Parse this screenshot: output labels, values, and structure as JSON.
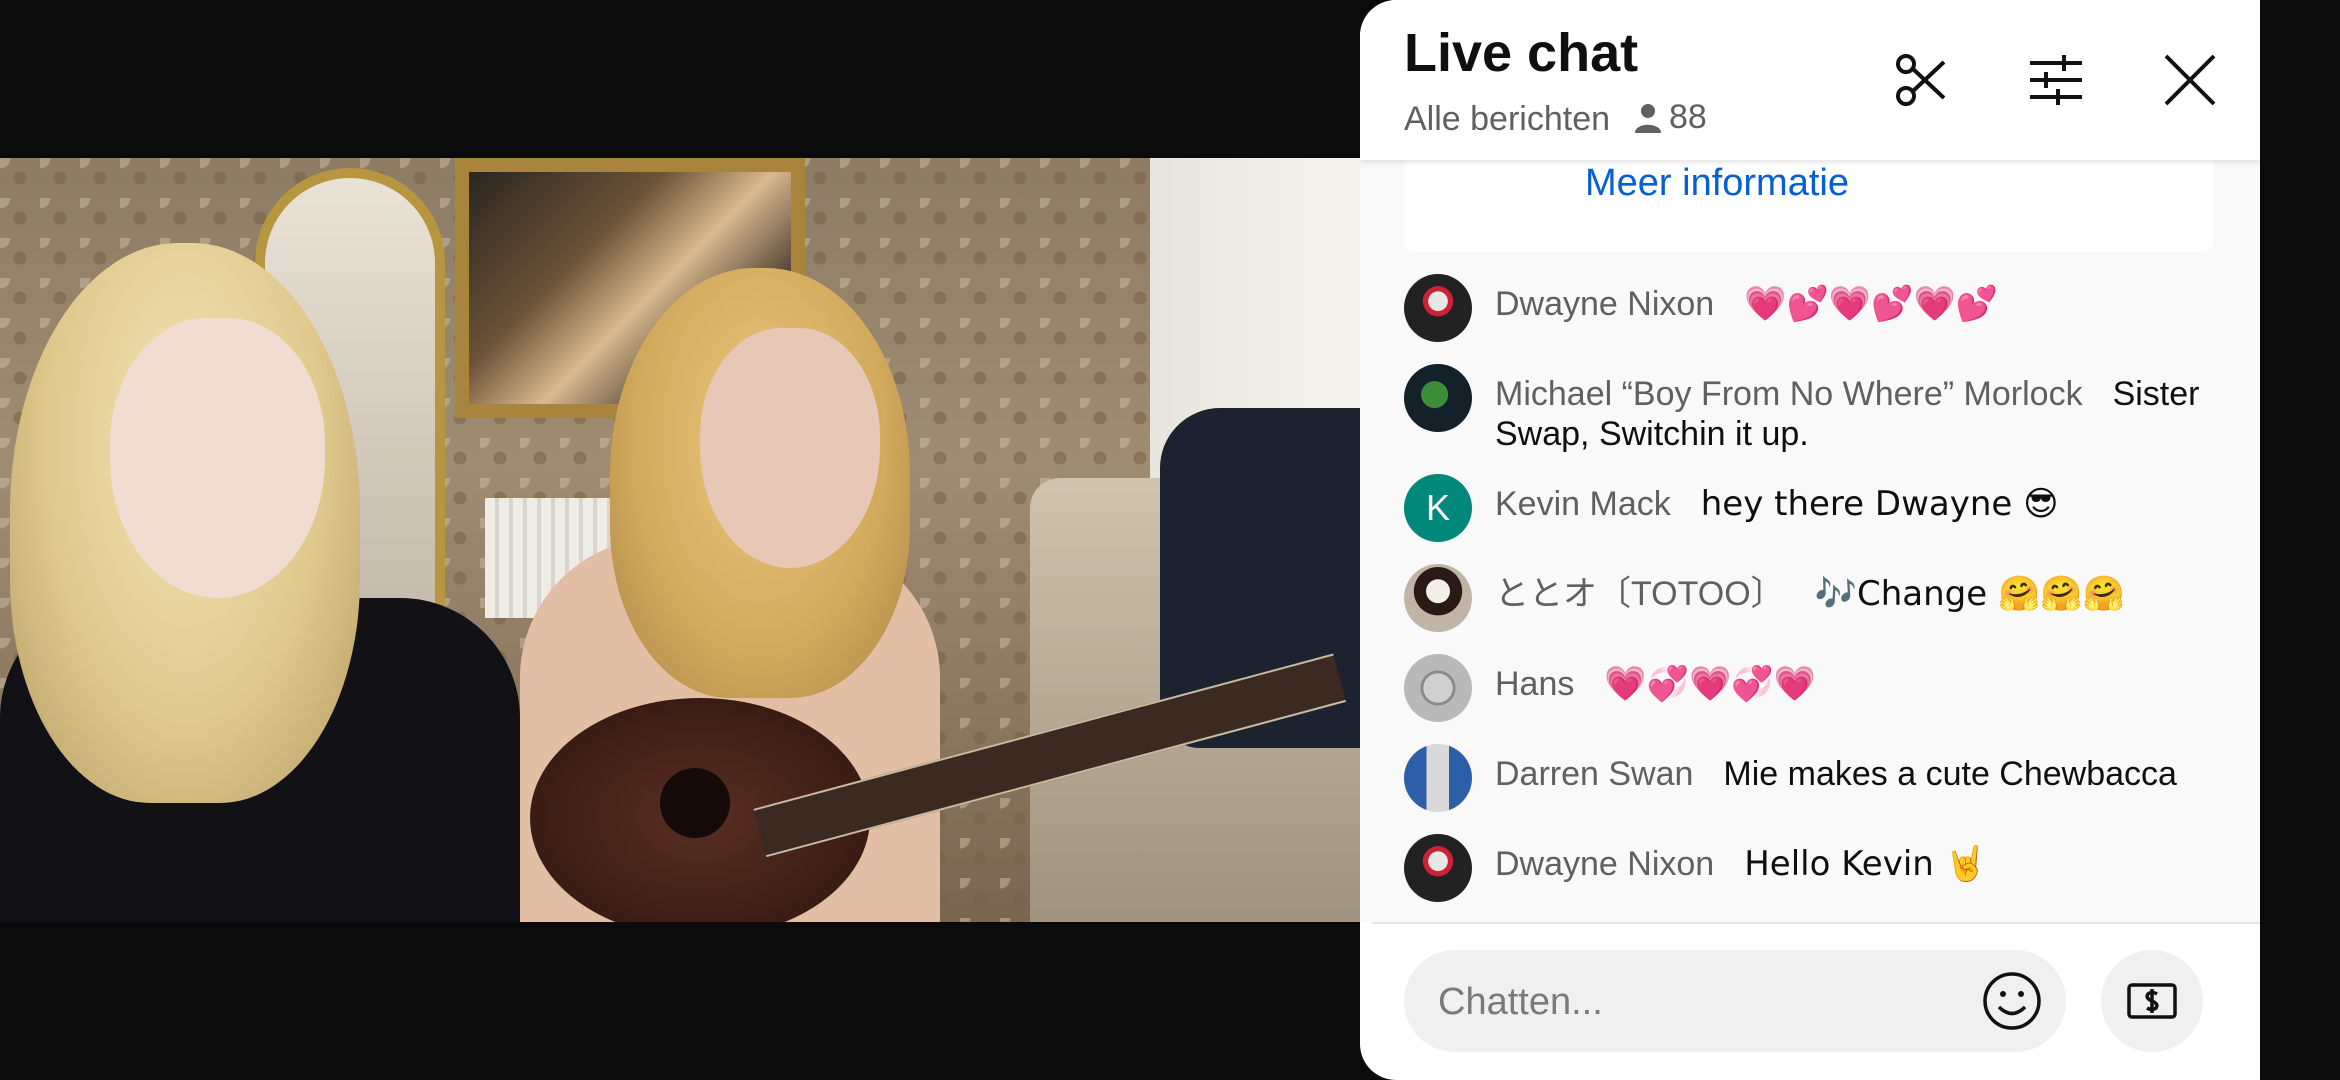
{
  "chat": {
    "title": "Live chat",
    "filter_label": "Alle berichten",
    "viewer_count": "88",
    "info_link": "Meer informatie",
    "input_placeholder": "Chatten...",
    "messages": [
      {
        "author": "Dwayne Nixon",
        "text": "💗💕💗💕💗💕"
      },
      {
        "author": "Michael “Boy From No Where” Morlock",
        "text": "Sister Swap, Switchin it up."
      },
      {
        "author": "Kevin Mack",
        "avatar_letter": "K",
        "text": "hey there Dwayne 😎"
      },
      {
        "author": "ととオ〔TOTOO〕",
        "text": "🎶Change 🤗🤗🤗"
      },
      {
        "author": "Hans",
        "text": "💗💞💗💞💗"
      },
      {
        "author": "Darren Swan",
        "text": "Mie makes a cute Chewbacca"
      },
      {
        "author": "Dwayne Nixon",
        "text": "Hello Kevin 🤘"
      }
    ],
    "icons": {
      "clip": "scissors-icon",
      "settings": "sliders-icon",
      "close": "close-icon",
      "viewers": "person-icon",
      "emoji": "smiley-icon",
      "super_chat": "money-icon"
    },
    "colors": {
      "link": "#065fd4",
      "author": "#606060",
      "avatar_k": "#00897b"
    }
  }
}
